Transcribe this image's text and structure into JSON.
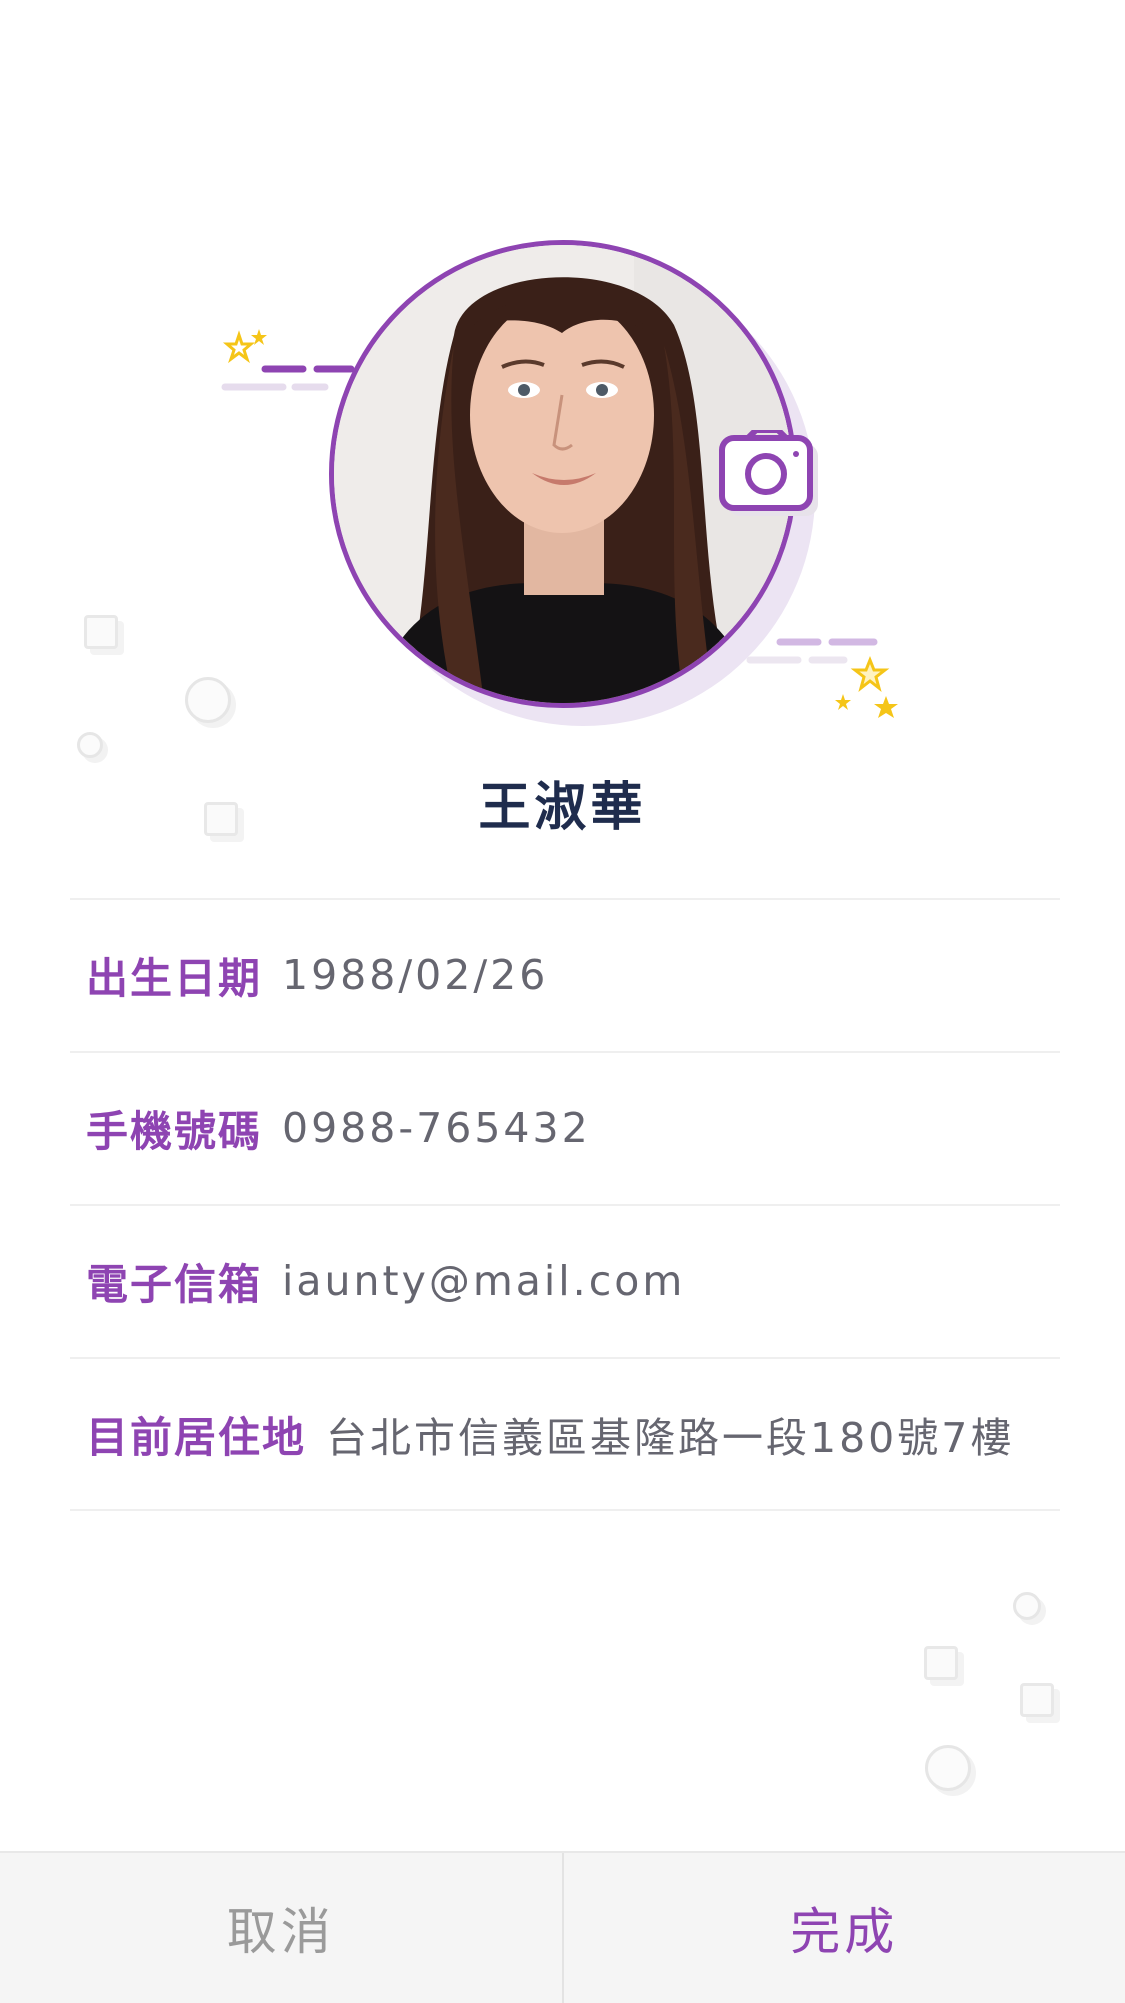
{
  "profile": {
    "name": "王淑華",
    "avatar_icon": "portrait-photo",
    "camera_icon": "camera-icon"
  },
  "fields": [
    {
      "label": "出生日期",
      "value": "1988/02/26"
    },
    {
      "label": "手機號碼",
      "value": "0988-765432"
    },
    {
      "label": "電子信箱",
      "value": "iaunty@mail.com"
    },
    {
      "label": "目前居住地",
      "value": "台北市信義區基隆路一段180號7樓"
    }
  ],
  "actions": {
    "cancel_label": "取消",
    "done_label": "完成"
  },
  "colors": {
    "accent": "#8e44b2",
    "name_text": "#1f2c4d",
    "value_text": "#666670",
    "star": "#f5c518"
  }
}
